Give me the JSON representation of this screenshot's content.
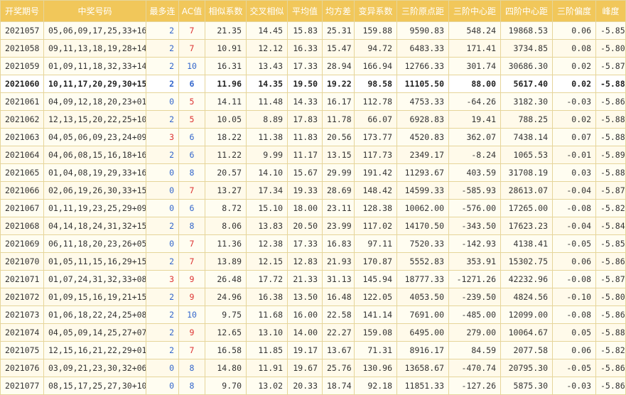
{
  "colors": {
    "header_bg": "#f1c75a",
    "header_text": "#ffffff",
    "border": "#e6d59a",
    "row_bg": "#fffdf1",
    "consec_0": "#3366cc",
    "consec_2": "#3366cc",
    "consec_3": "#dd3333",
    "ac_red": "#dd3333",
    "ac_blue": "#3366cc"
  },
  "headers": [
    "开奖期号",
    "中奖号码",
    "最多连",
    "AC值",
    "相似系数",
    "交叉相似",
    "平均值",
    "均方差",
    "变异系数",
    "三阶原点距",
    "三阶中心距",
    "四阶中心距",
    "三阶偏度",
    "峰度"
  ],
  "rows": [
    {
      "period": "2021057",
      "numbers": "05,06,09,17,25,33+16",
      "consec": "2",
      "ac": "7",
      "sim": "21.35",
      "cross": "14.45",
      "mean": "15.83",
      "std": "25.31",
      "cv": "159.88",
      "m3": "9590.83",
      "c3": "548.24",
      "c4": "19868.53",
      "skew": "0.06",
      "kurt": "-5.85"
    },
    {
      "period": "2021058",
      "numbers": "09,11,13,18,19,28+14",
      "consec": "2",
      "ac": "7",
      "sim": "10.91",
      "cross": "12.12",
      "mean": "16.33",
      "std": "15.47",
      "cv": "94.72",
      "m3": "6483.33",
      "c3": "171.41",
      "c4": "3734.85",
      "skew": "0.08",
      "kurt": "-5.80"
    },
    {
      "period": "2021059",
      "numbers": "01,09,11,18,32,33+14",
      "consec": "2",
      "ac": "10",
      "sim": "16.31",
      "cross": "13.43",
      "mean": "17.33",
      "std": "28.94",
      "cv": "166.94",
      "m3": "12766.33",
      "c3": "301.74",
      "c4": "30686.30",
      "skew": "0.02",
      "kurt": "-5.87"
    },
    {
      "period": "2021060",
      "numbers": "10,11,17,20,29,30+15",
      "consec": "2",
      "ac": "6",
      "sim": "11.96",
      "cross": "14.35",
      "mean": "19.50",
      "std": "19.22",
      "cv": "98.58",
      "m3": "11105.50",
      "c3": "88.00",
      "c4": "5617.40",
      "skew": "0.02",
      "kurt": "-5.88",
      "highlight": true
    },
    {
      "period": "2021061",
      "numbers": "04,09,12,18,20,23+01",
      "consec": "0",
      "ac": "5",
      "sim": "14.11",
      "cross": "11.48",
      "mean": "14.33",
      "std": "16.17",
      "cv": "112.78",
      "m3": "4753.33",
      "c3": "-64.26",
      "c4": "3182.30",
      "skew": "-0.03",
      "kurt": "-5.86"
    },
    {
      "period": "2021062",
      "numbers": "12,13,15,20,22,25+10",
      "consec": "2",
      "ac": "5",
      "sim": "10.05",
      "cross": "8.89",
      "mean": "17.83",
      "std": "11.78",
      "cv": "66.07",
      "m3": "6928.83",
      "c3": "19.41",
      "c4": "788.25",
      "skew": "0.02",
      "kurt": "-5.88"
    },
    {
      "period": "2021063",
      "numbers": "04,05,06,09,23,24+09",
      "consec": "3",
      "ac": "6",
      "sim": "18.22",
      "cross": "11.38",
      "mean": "11.83",
      "std": "20.56",
      "cv": "173.77",
      "m3": "4520.83",
      "c3": "362.07",
      "c4": "7438.14",
      "skew": "0.07",
      "kurt": "-5.88"
    },
    {
      "period": "2021064",
      "numbers": "04,06,08,15,16,18+16",
      "consec": "2",
      "ac": "6",
      "sim": "11.22",
      "cross": "9.99",
      "mean": "11.17",
      "std": "13.15",
      "cv": "117.73",
      "m3": "2349.17",
      "c3": "-8.24",
      "c4": "1065.53",
      "skew": "-0.01",
      "kurt": "-5.89"
    },
    {
      "period": "2021065",
      "numbers": "01,04,08,19,29,33+16",
      "consec": "0",
      "ac": "8",
      "sim": "20.57",
      "cross": "14.10",
      "mean": "15.67",
      "std": "29.99",
      "cv": "191.42",
      "m3": "11293.67",
      "c3": "403.59",
      "c4": "31708.19",
      "skew": "0.03",
      "kurt": "-5.88"
    },
    {
      "period": "2021066",
      "numbers": "02,06,19,26,30,33+15",
      "consec": "0",
      "ac": "7",
      "sim": "13.27",
      "cross": "17.34",
      "mean": "19.33",
      "std": "28.69",
      "cv": "148.42",
      "m3": "14599.33",
      "c3": "-585.93",
      "c4": "28613.07",
      "skew": "-0.04",
      "kurt": "-5.87"
    },
    {
      "period": "2021067",
      "numbers": "01,11,19,23,25,29+09",
      "consec": "0",
      "ac": "6",
      "sim": "8.72",
      "cross": "15.10",
      "mean": "18.00",
      "std": "23.11",
      "cv": "128.38",
      "m3": "10062.00",
      "c3": "-576.00",
      "c4": "17265.00",
      "skew": "-0.08",
      "kurt": "-5.82"
    },
    {
      "period": "2021068",
      "numbers": "04,14,18,24,31,32+15",
      "consec": "2",
      "ac": "8",
      "sim": "8.06",
      "cross": "13.83",
      "mean": "20.50",
      "std": "23.99",
      "cv": "117.02",
      "m3": "14170.50",
      "c3": "-343.50",
      "c4": "17623.23",
      "skew": "-0.04",
      "kurt": "-5.84"
    },
    {
      "period": "2021069",
      "numbers": "06,11,18,20,23,26+05",
      "consec": "0",
      "ac": "7",
      "sim": "11.36",
      "cross": "12.38",
      "mean": "17.33",
      "std": "16.83",
      "cv": "97.11",
      "m3": "7520.33",
      "c3": "-142.93",
      "c4": "4138.41",
      "skew": "-0.05",
      "kurt": "-5.85"
    },
    {
      "period": "2021070",
      "numbers": "01,05,11,15,16,29+15",
      "consec": "2",
      "ac": "7",
      "sim": "13.89",
      "cross": "12.15",
      "mean": "12.83",
      "std": "21.93",
      "cv": "170.87",
      "m3": "5552.83",
      "c3": "353.91",
      "c4": "15302.75",
      "skew": "0.06",
      "kurt": "-5.86"
    },
    {
      "period": "2021071",
      "numbers": "01,07,24,31,32,33+08",
      "consec": "3",
      "ac": "9",
      "sim": "26.48",
      "cross": "17.72",
      "mean": "21.33",
      "std": "31.13",
      "cv": "145.94",
      "m3": "18777.33",
      "c3": "-1271.26",
      "c4": "42232.96",
      "skew": "-0.08",
      "kurt": "-5.87"
    },
    {
      "period": "2021072",
      "numbers": "01,09,15,16,19,21+15",
      "consec": "2",
      "ac": "9",
      "sim": "24.96",
      "cross": "16.38",
      "mean": "13.50",
      "std": "16.48",
      "cv": "122.05",
      "m3": "4053.50",
      "c3": "-239.50",
      "c4": "4824.56",
      "skew": "-0.10",
      "kurt": "-5.80"
    },
    {
      "period": "2021073",
      "numbers": "01,06,18,22,24,25+08",
      "consec": "2",
      "ac": "10",
      "sim": "9.75",
      "cross": "11.68",
      "mean": "16.00",
      "std": "22.58",
      "cv": "141.14",
      "m3": "7691.00",
      "c3": "-485.00",
      "c4": "12099.00",
      "skew": "-0.08",
      "kurt": "-5.86"
    },
    {
      "period": "2021074",
      "numbers": "04,05,09,14,25,27+07",
      "consec": "2",
      "ac": "9",
      "sim": "12.65",
      "cross": "13.10",
      "mean": "14.00",
      "std": "22.27",
      "cv": "159.08",
      "m3": "6495.00",
      "c3": "279.00",
      "c4": "10064.67",
      "skew": "0.05",
      "kurt": "-5.88"
    },
    {
      "period": "2021075",
      "numbers": "12,15,16,21,22,29+01",
      "consec": "2",
      "ac": "7",
      "sim": "16.58",
      "cross": "11.85",
      "mean": "19.17",
      "std": "13.67",
      "cv": "71.31",
      "m3": "8916.17",
      "c3": "84.59",
      "c4": "2077.58",
      "skew": "0.06",
      "kurt": "-5.82"
    },
    {
      "period": "2021076",
      "numbers": "03,09,21,23,30,32+06",
      "consec": "0",
      "ac": "8",
      "sim": "14.80",
      "cross": "11.91",
      "mean": "19.67",
      "std": "25.76",
      "cv": "130.96",
      "m3": "13658.67",
      "c3": "-470.74",
      "c4": "20795.30",
      "skew": "-0.05",
      "kurt": "-5.86"
    },
    {
      "period": "2021077",
      "numbers": "08,15,17,25,27,30+10",
      "consec": "0",
      "ac": "8",
      "sim": "9.70",
      "cross": "13.02",
      "mean": "20.33",
      "std": "18.74",
      "cv": "92.18",
      "m3": "11851.33",
      "c3": "-127.26",
      "c4": "5875.30",
      "skew": "-0.03",
      "kurt": "-5.86"
    }
  ]
}
